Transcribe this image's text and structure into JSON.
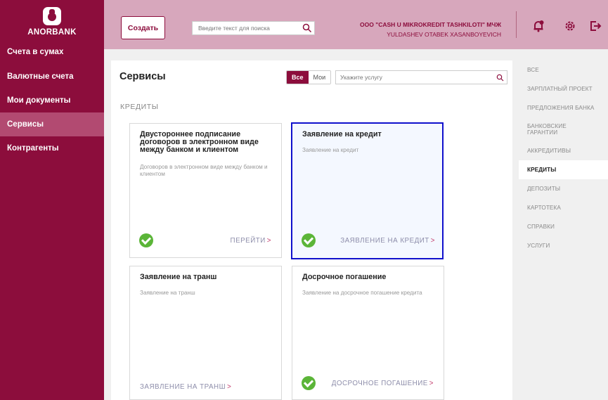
{
  "brand": {
    "name": "ANORBANK",
    "primary": "#8c0d3c",
    "header_bg": "#d7a7bc",
    "success": "#5bb538",
    "focus": "#1010cc"
  },
  "sidebar": {
    "items": [
      {
        "label": "Счета в сумах",
        "active": false
      },
      {
        "label": "Валютные счета",
        "active": false
      },
      {
        "label": "Мои документы",
        "active": false
      },
      {
        "label": "Сервисы",
        "active": true
      },
      {
        "label": "Контрагенты",
        "active": false
      }
    ]
  },
  "header": {
    "create_label": "Создать",
    "search_placeholder": "Введите текст для поиска",
    "company_name": "OOO \"CASH U MIKROKREDIT TASHKILOTI\" МЧЖ",
    "user_name": "YULDASHEV OTABEK XASANBOYEVICH",
    "icons": [
      "notification-bell-icon",
      "settings-gear-icon",
      "logout-icon"
    ]
  },
  "main": {
    "title": "Сервисы",
    "toggle": {
      "all": "Все",
      "mine": "Мои",
      "selected": "Все"
    },
    "search_placeholder": "Укажите услугу",
    "section": "КРЕДИТЫ",
    "cards": [
      {
        "title": "Двустороннее подписание договоров в электронном виде между банком и клиентом",
        "description": "Договоров в электронном виде между банком и клиентом",
        "action": "ПЕРЕЙТИ",
        "checked": true
      },
      {
        "title": "Заявление на кредит",
        "description": "Заявление на кредит",
        "action": "ЗАЯВЛЕНИЕ НА КРЕДИТ",
        "checked": true,
        "selected": true
      },
      {
        "title": "Заявление на транш",
        "description": "Заявление на транш",
        "action": "ЗАЯВЛЕНИЕ НА ТРАНШ",
        "checked": false
      },
      {
        "title": "Досрочное погашение",
        "description": "Заявление на досрочное погашение кредита",
        "action": "ДОСРОЧНОЕ ПОГАШЕНИЕ",
        "checked": true
      }
    ],
    "arrow": ">"
  },
  "categories": [
    {
      "label": "ВСЕ",
      "active": false
    },
    {
      "label": "ЗАРПЛАТНЫЙ ПРОЕКТ",
      "active": false
    },
    {
      "label": "ПРЕДЛОЖЕНИЯ БАНКА",
      "active": false
    },
    {
      "label": "БАНКОВСКИЕ ГАРАНТИИ",
      "active": false
    },
    {
      "label": "АККРЕДИТИВЫ",
      "active": false
    },
    {
      "label": "КРЕДИТЫ",
      "active": true
    },
    {
      "label": "ДЕПОЗИТЫ",
      "active": false
    },
    {
      "label": "КАРТОТЕКА",
      "active": false
    },
    {
      "label": "СПРАВКИ",
      "active": false
    },
    {
      "label": "УСЛУГИ",
      "active": false
    }
  ]
}
